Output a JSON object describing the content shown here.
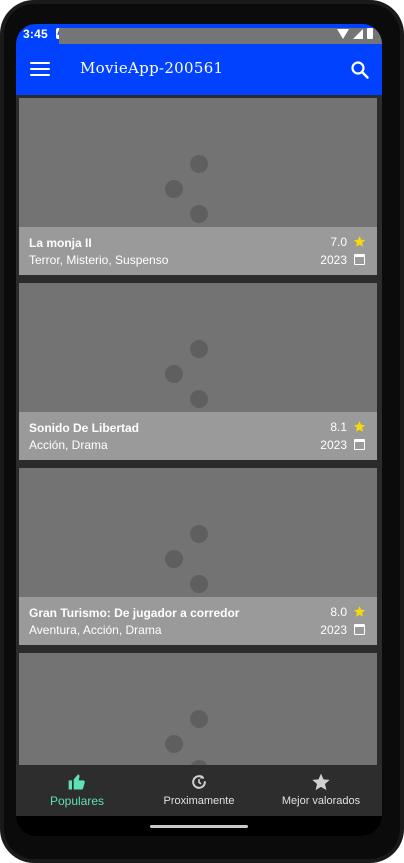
{
  "status_bar": {
    "time": "3:45"
  },
  "app_bar": {
    "title": "MovieApp-200561"
  },
  "movies": [
    {
      "title": "La monja II",
      "genres": "Terror, Misterio, Suspenso",
      "rating": "7.0",
      "year": "2023"
    },
    {
      "title": "Sonido De Libertad",
      "genres": "Acción, Drama",
      "rating": "8.1",
      "year": "2023"
    },
    {
      "title": "Gran Turismo: De jugador a corredor",
      "genres": "Aventura, Acción, Drama",
      "rating": "8.0",
      "year": "2023"
    }
  ],
  "bottom_nav": {
    "items": [
      {
        "label": "Populares",
        "icon": "thumbs-up-icon",
        "active": true
      },
      {
        "label": "Proximamente",
        "icon": "refresh-clock-icon",
        "active": false
      },
      {
        "label": "Mejor valorados",
        "icon": "star-icon",
        "active": false
      }
    ]
  },
  "colors": {
    "app_bar": "#0042ff",
    "active_nav": "#5de2b2",
    "star": "#f5d90a"
  }
}
